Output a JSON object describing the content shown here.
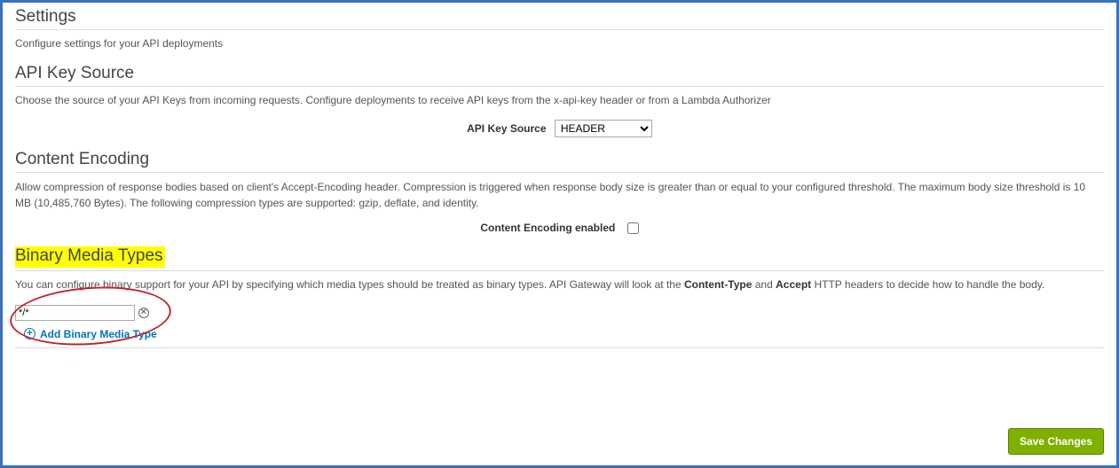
{
  "settings": {
    "title": "Settings",
    "description": "Configure settings for your API deployments"
  },
  "apiKeySource": {
    "title": "API Key Source",
    "description": "Choose the source of your API Keys from incoming requests. Configure deployments to receive API keys from the x-api-key header or from a Lambda Authorizer",
    "label": "API Key Source",
    "selected": "HEADER",
    "options": [
      "HEADER"
    ]
  },
  "contentEncoding": {
    "title": "Content Encoding",
    "description": "Allow compression of response bodies based on client's Accept-Encoding header. Compression is triggered when response body size is greater than or equal to your configured threshold. The maximum body size threshold is 10 MB (10,485,760 Bytes). The following compression types are supported: gzip, deflate, and identity.",
    "label": "Content Encoding enabled",
    "checked": false
  },
  "binaryMedia": {
    "title": "Binary Media Types",
    "descPrefix": "You can configure binary support for your API by specifying which media types should be treated as binary types. API Gateway will look at the ",
    "strong1": "Content-Type",
    "mid": " and ",
    "strong2": "Accept",
    "descSuffix": " HTTP headers to decide how to handle the body.",
    "inputValue": "*/*",
    "addLabel": "Add Binary Media Type"
  },
  "saveButton": "Save Changes"
}
